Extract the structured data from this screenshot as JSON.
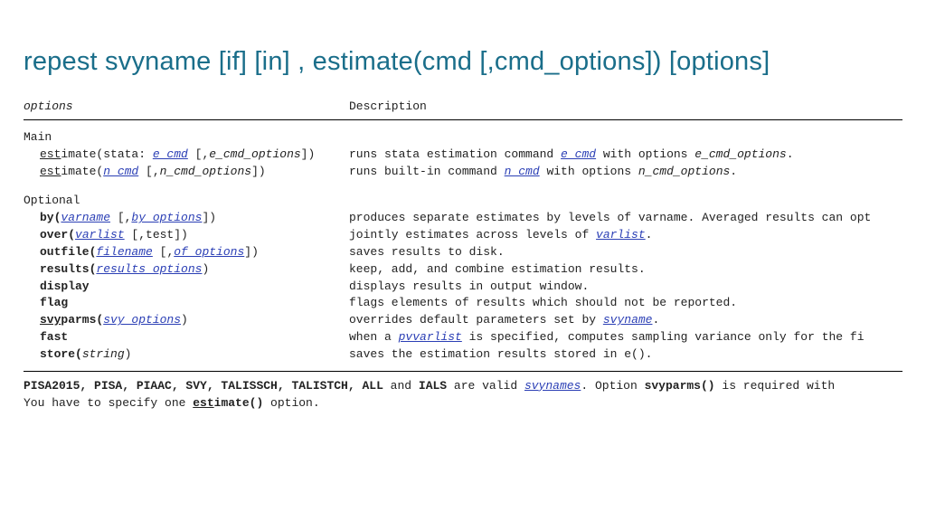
{
  "title": "repest svyname [if] [in] , estimate(cmd [,cmd_options]) [options]",
  "header": {
    "left": "options",
    "right": "Description"
  },
  "section_main_label": "Main",
  "main": {
    "r0": {
      "abbrev": "est",
      "rest": "imate(stata: ",
      "link1": "e_cmd",
      "mid1": " [,",
      "ital1": "e_cmd_options",
      "end1": "])",
      "desc_a": "runs stata estimation command ",
      "desc_link": "e_cmd",
      "desc_b": " with options ",
      "desc_ital": "e_cmd_options",
      "desc_c": "."
    },
    "r1": {
      "abbrev": "est",
      "rest": "imate(",
      "link1": "n_cmd",
      "mid1": " [,",
      "ital1": "n_cmd_options",
      "end1": "])",
      "desc_a": "runs built-in command ",
      "desc_link": "n_cmd",
      "desc_b": " with options ",
      "desc_ital": "n_cmd_options",
      "desc_c": "."
    }
  },
  "section_optional_label": "Optional",
  "opt": {
    "by": {
      "name": "by(",
      "arg1": "varname",
      "mid": " [,",
      "arg2": "by_options",
      "end": "])",
      "desc": "produces separate estimates by levels of varname. Averaged results can opt"
    },
    "over": {
      "name": "over(",
      "arg1": "varlist",
      "mid": " [,test])",
      "desc_a": "jointly estimates across levels of ",
      "desc_link": "varlist",
      "desc_b": "."
    },
    "outfile": {
      "name": "outfile(",
      "arg1": "filename",
      "mid": " [,",
      "arg2": "of_options",
      "end": "])",
      "desc": " saves results to disk."
    },
    "results": {
      "name": "results(",
      "arg1": "results_options",
      "end": ")",
      "desc": "keep, add, and combine estimation results."
    },
    "display": {
      "name": "display",
      "desc": "displays results in output window."
    },
    "flag": {
      "name": "flag",
      "desc": "flags elements of results which should not be reported."
    },
    "svyparms": {
      "abbrev": "svy",
      "rest": "parms(",
      "arg1": "svy_options",
      "end": ")",
      "desc_a": "overrides default parameters set by ",
      "desc_link": "svyname",
      "desc_b": "."
    },
    "fast": {
      "name": "fast",
      "desc_a": " when a ",
      "desc_link": "pvvarlist",
      "desc_b": " is specified, computes sampling variance only for the fi"
    },
    "store": {
      "name": "store(",
      "arg1": "string",
      "end": ")",
      "desc": " saves the estimation results stored in e()."
    }
  },
  "notes": {
    "line1_a": "PISA2015, PISA, PIAAC, SVY, TALISSCH, TALISTCH, ALL",
    "line1_b": " and ",
    "line1_c": "IALS",
    "line1_d": " are valid ",
    "line1_link": "svynames",
    "line1_e": ". Option ",
    "line1_f": "svyparms()",
    "line1_g": "  is required with ",
    "line2_a": "You have to specify one ",
    "line2_abbrev": "est",
    "line2_rest": "imate()",
    "line2_b": " option."
  }
}
